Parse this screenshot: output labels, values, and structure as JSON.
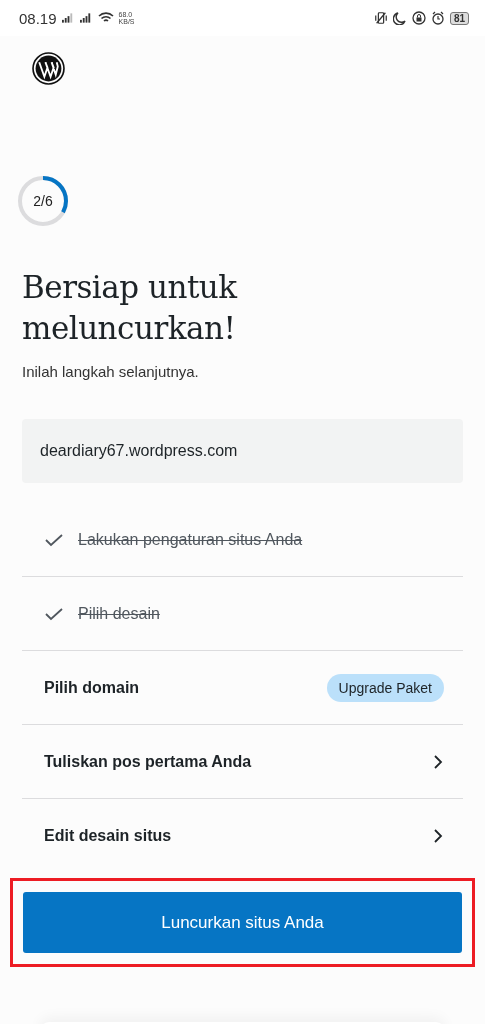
{
  "status_bar": {
    "time": "08.19",
    "net_speed": "68.0",
    "net_unit": "KB/S",
    "battery": "81"
  },
  "progress": {
    "label": "2/6",
    "level": 0.33
  },
  "title": "Bersiap untuk meluncurkan!",
  "subtitle": "Inilah langkah selanjutnya.",
  "site_address": "deardiary67.wordpress.com",
  "steps": [
    {
      "label": "Lakukan pengaturan situs Anda",
      "kind": "done",
      "completed": true
    },
    {
      "label": "Pilih desain",
      "kind": "done",
      "completed": true
    },
    {
      "label": "Pilih domain",
      "kind": "badge",
      "completed": false,
      "badge": "Upgrade Paket"
    },
    {
      "label": "Tuliskan pos pertama Anda",
      "kind": "link",
      "completed": false
    },
    {
      "label": "Edit desain situs",
      "kind": "link",
      "completed": false
    }
  ],
  "launch_button": {
    "label": "Luncurkan situs Anda",
    "highlighted": true
  }
}
